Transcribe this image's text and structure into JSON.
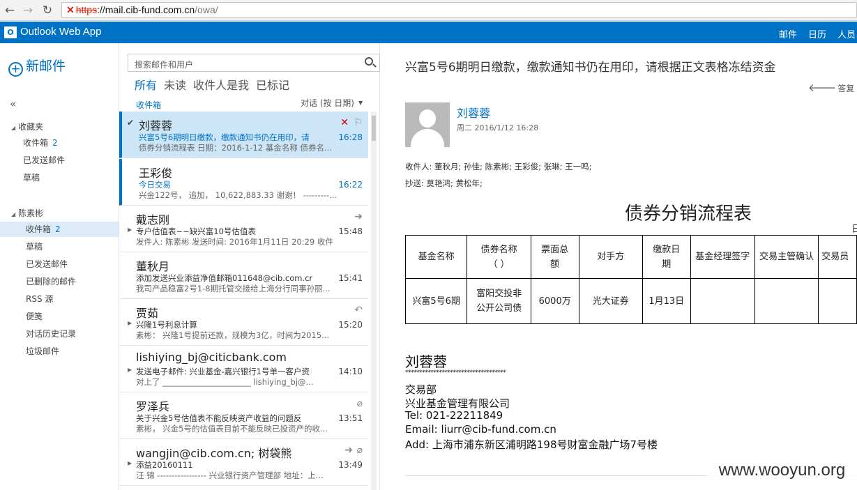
{
  "browser": {
    "url_protocol": "https",
    "url_host": "://mail.cib-fund.com.cn",
    "url_path": "/owa/"
  },
  "app": {
    "logo_letters": "O",
    "title": "Outlook Web App",
    "nav": [
      "邮件",
      "日历",
      "人员"
    ]
  },
  "left": {
    "new_mail": "新邮件",
    "collapse": "«",
    "favorites_header": "收藏夹",
    "favorites": [
      {
        "label": "收件箱",
        "count": "2"
      },
      {
        "label": "已发送邮件",
        "count": ""
      },
      {
        "label": "草稿",
        "count": ""
      }
    ],
    "account_header": "陈素彬",
    "folders": [
      {
        "label": "收件箱",
        "count": "2"
      },
      {
        "label": "草稿",
        "count": ""
      },
      {
        "label": "已发送邮件",
        "count": ""
      },
      {
        "label": "已删除的邮件",
        "count": ""
      },
      {
        "label": "RSS 源",
        "count": ""
      },
      {
        "label": "便笺",
        "count": ""
      },
      {
        "label": "对话历史记录",
        "count": ""
      },
      {
        "label": "垃圾邮件",
        "count": ""
      }
    ]
  },
  "list": {
    "search_placeholder": "搜索邮件和用户",
    "filters": [
      "所有",
      "未读",
      "收件人是我",
      "已标记"
    ],
    "folder_name": "收件箱",
    "sort_label": "对话 (按 日期)",
    "messages": [
      {
        "from": "刘蓉蓉",
        "subject": "兴富5号6期明日缴款，缴款通知书仍在用印，请",
        "preview": "债券分销流程表 日期：2016-1-12 基金名称  债券名...",
        "time": "16:28"
      },
      {
        "from": "王彩俊",
        "subject": "今日交易",
        "preview": "兴金122号， 追加， 10,622,883.33    谢谢！ ---------...",
        "time": "16:22"
      },
      {
        "from": "戴志刚",
        "subject": "专户估值表~~缺兴富10号估值表",
        "preview": "发件人: 陈素彬 发送时间: 2016年1月11日 20:29 收件...",
        "time": "15:48"
      },
      {
        "from": "董秋月",
        "subject": "添加发送兴业添益净值邮箱011648@cib.com.cr",
        "preview": "我司产品稳富2号1-8期托管交接给上海分行同事孙丽...",
        "time": "15:41"
      },
      {
        "from": "贾茹",
        "subject": "兴隆1号利息计算",
        "preview": "素彬： 兴隆1号提前还款，规模为3亿，时间为2015...",
        "time": "15:20"
      },
      {
        "from": "lishiying_bj@citicbank.com",
        "subject": "发送电子邮件: 兴业基金-嘉兴银行1号单一客户资",
        "preview": "对上了 ______________________ lishiying_bj@...",
        "time": "14:10"
      },
      {
        "from": "罗泽兵",
        "subject": "关于兴金5号估值表不能反映资产收益的问题反",
        "preview": "素彬， 兴金5号的估值表目前不能反映已投资产的收...",
        "time": "13:51"
      },
      {
        "from": "wangjin@cib.com.cn; 树袋熊",
        "subject": "添益20160111",
        "preview": "汪 锦 ----------------- 兴业银行资产管理部 地址：上...",
        "time": "13:49"
      }
    ]
  },
  "reading": {
    "subject": "兴富5号6期明日缴款，缴款通知书仍在用印，请根据正文表格冻结资金",
    "reply": "答复",
    "sender": "刘蓉蓉",
    "date": "周二 2016/1/12 16:28",
    "to": "收件人:   董秋月;   孙佳;   陈素彬;   王彩俊;   张琳;   王一鸣;",
    "cc": "抄送:   莫艳鸿;   黄松年;",
    "doc_title": "债券分销流程表",
    "edge_text": "日",
    "table": {
      "headers": [
        "基金名称",
        "债券名称\n（        ）",
        "票面总额",
        "对手方",
        "缴款日期",
        "基金经理签字",
        "交易主管确认",
        "交易员"
      ],
      "row": [
        "兴富5号6期",
        "富阳交投非公开公司债",
        "6000万",
        "光大证券",
        "1月13日",
        "",
        "",
        ""
      ]
    },
    "signature": {
      "name": "刘蓉蓉",
      "stars": "************************************",
      "dept": "交易部",
      "company": "兴业基金管理有限公司",
      "tel": "Tel: 021-22211849",
      "email": "Email: liurr@cib-fund.com.cn",
      "addr": "Add: 上海市浦东新区浦明路198号财富金融广场7号楼"
    }
  },
  "watermark": "www.wooyun.org"
}
